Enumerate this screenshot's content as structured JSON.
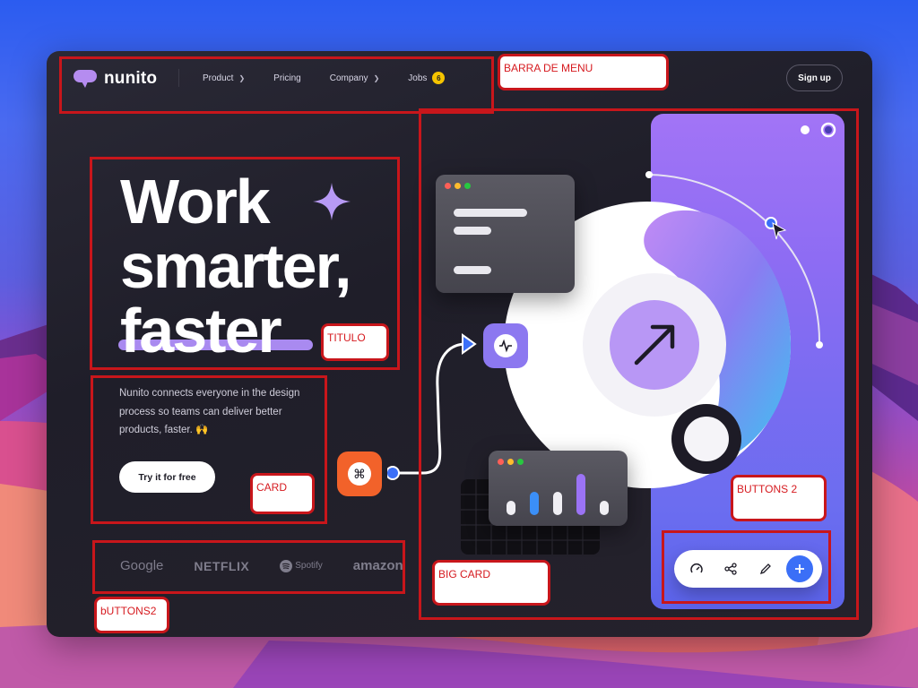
{
  "nav": {
    "logo_text": "nunito",
    "items": [
      {
        "label": "Product",
        "dropdown": true
      },
      {
        "label": "Pricing",
        "dropdown": false
      },
      {
        "label": "Company",
        "dropdown": true
      },
      {
        "label": "Jobs",
        "badge": "6"
      }
    ],
    "signup_label": "Sign up"
  },
  "hero": {
    "title_lines": [
      "Work",
      "smarter,",
      "faster"
    ],
    "description": "Nunito connects everyone in the design process so teams can deliver better products, faster. 🙌",
    "cta_label": "Try it for free"
  },
  "brands": [
    "Google",
    "NETFLIX",
    "Spotify",
    "amazon"
  ],
  "toolbar": {
    "icons": [
      "gauge-icon",
      "share-icon",
      "pencil-icon",
      "plus-icon"
    ]
  },
  "annotations": {
    "barra_menu": "BARRA DE MENU",
    "titulo": "TITULO",
    "card": "CARD",
    "buttons_2": "BUTTONS 2",
    "big_card": "BIG CARD",
    "buttons2_lower": "bUTTONS2"
  },
  "colors": {
    "accent_purple": "#a98af0",
    "dark_panel": "#1f1e29",
    "annotation_red": "#c8161b",
    "badge_yellow": "#f5c400",
    "button_blue": "#3b6ff7",
    "orange": "#f2622a"
  }
}
